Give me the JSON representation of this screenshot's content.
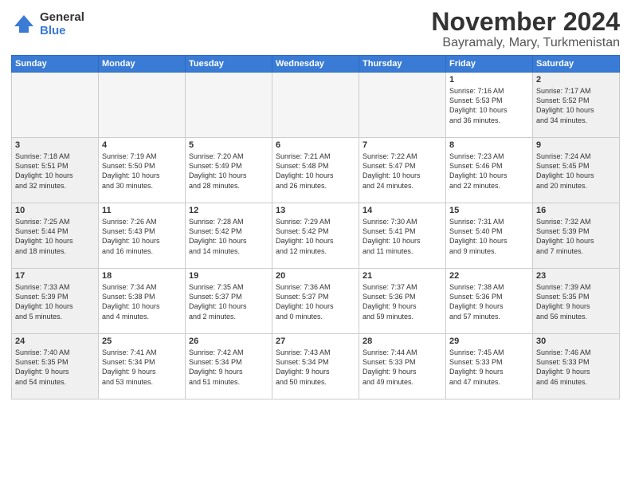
{
  "logo": {
    "general": "General",
    "blue": "Blue"
  },
  "header": {
    "month": "November 2024",
    "location": "Bayramaly, Mary, Turkmenistan"
  },
  "weekdays": [
    "Sunday",
    "Monday",
    "Tuesday",
    "Wednesday",
    "Thursday",
    "Friday",
    "Saturday"
  ],
  "weeks": [
    [
      {
        "day": "",
        "info": "",
        "empty": true
      },
      {
        "day": "",
        "info": "",
        "empty": true
      },
      {
        "day": "",
        "info": "",
        "empty": true
      },
      {
        "day": "",
        "info": "",
        "empty": true
      },
      {
        "day": "",
        "info": "",
        "empty": true
      },
      {
        "day": "1",
        "info": "Sunrise: 7:16 AM\nSunset: 5:53 PM\nDaylight: 10 hours\nand 36 minutes."
      },
      {
        "day": "2",
        "info": "Sunrise: 7:17 AM\nSunset: 5:52 PM\nDaylight: 10 hours\nand 34 minutes."
      }
    ],
    [
      {
        "day": "3",
        "info": "Sunrise: 7:18 AM\nSunset: 5:51 PM\nDaylight: 10 hours\nand 32 minutes."
      },
      {
        "day": "4",
        "info": "Sunrise: 7:19 AM\nSunset: 5:50 PM\nDaylight: 10 hours\nand 30 minutes."
      },
      {
        "day": "5",
        "info": "Sunrise: 7:20 AM\nSunset: 5:49 PM\nDaylight: 10 hours\nand 28 minutes."
      },
      {
        "day": "6",
        "info": "Sunrise: 7:21 AM\nSunset: 5:48 PM\nDaylight: 10 hours\nand 26 minutes."
      },
      {
        "day": "7",
        "info": "Sunrise: 7:22 AM\nSunset: 5:47 PM\nDaylight: 10 hours\nand 24 minutes."
      },
      {
        "day": "8",
        "info": "Sunrise: 7:23 AM\nSunset: 5:46 PM\nDaylight: 10 hours\nand 22 minutes."
      },
      {
        "day": "9",
        "info": "Sunrise: 7:24 AM\nSunset: 5:45 PM\nDaylight: 10 hours\nand 20 minutes."
      }
    ],
    [
      {
        "day": "10",
        "info": "Sunrise: 7:25 AM\nSunset: 5:44 PM\nDaylight: 10 hours\nand 18 minutes."
      },
      {
        "day": "11",
        "info": "Sunrise: 7:26 AM\nSunset: 5:43 PM\nDaylight: 10 hours\nand 16 minutes."
      },
      {
        "day": "12",
        "info": "Sunrise: 7:28 AM\nSunset: 5:42 PM\nDaylight: 10 hours\nand 14 minutes."
      },
      {
        "day": "13",
        "info": "Sunrise: 7:29 AM\nSunset: 5:42 PM\nDaylight: 10 hours\nand 12 minutes."
      },
      {
        "day": "14",
        "info": "Sunrise: 7:30 AM\nSunset: 5:41 PM\nDaylight: 10 hours\nand 11 minutes."
      },
      {
        "day": "15",
        "info": "Sunrise: 7:31 AM\nSunset: 5:40 PM\nDaylight: 10 hours\nand 9 minutes."
      },
      {
        "day": "16",
        "info": "Sunrise: 7:32 AM\nSunset: 5:39 PM\nDaylight: 10 hours\nand 7 minutes."
      }
    ],
    [
      {
        "day": "17",
        "info": "Sunrise: 7:33 AM\nSunset: 5:39 PM\nDaylight: 10 hours\nand 5 minutes."
      },
      {
        "day": "18",
        "info": "Sunrise: 7:34 AM\nSunset: 5:38 PM\nDaylight: 10 hours\nand 4 minutes."
      },
      {
        "day": "19",
        "info": "Sunrise: 7:35 AM\nSunset: 5:37 PM\nDaylight: 10 hours\nand 2 minutes."
      },
      {
        "day": "20",
        "info": "Sunrise: 7:36 AM\nSunset: 5:37 PM\nDaylight: 10 hours\nand 0 minutes."
      },
      {
        "day": "21",
        "info": "Sunrise: 7:37 AM\nSunset: 5:36 PM\nDaylight: 9 hours\nand 59 minutes."
      },
      {
        "day": "22",
        "info": "Sunrise: 7:38 AM\nSunset: 5:36 PM\nDaylight: 9 hours\nand 57 minutes."
      },
      {
        "day": "23",
        "info": "Sunrise: 7:39 AM\nSunset: 5:35 PM\nDaylight: 9 hours\nand 56 minutes."
      }
    ],
    [
      {
        "day": "24",
        "info": "Sunrise: 7:40 AM\nSunset: 5:35 PM\nDaylight: 9 hours\nand 54 minutes."
      },
      {
        "day": "25",
        "info": "Sunrise: 7:41 AM\nSunset: 5:34 PM\nDaylight: 9 hours\nand 53 minutes."
      },
      {
        "day": "26",
        "info": "Sunrise: 7:42 AM\nSunset: 5:34 PM\nDaylight: 9 hours\nand 51 minutes."
      },
      {
        "day": "27",
        "info": "Sunrise: 7:43 AM\nSunset: 5:34 PM\nDaylight: 9 hours\nand 50 minutes."
      },
      {
        "day": "28",
        "info": "Sunrise: 7:44 AM\nSunset: 5:33 PM\nDaylight: 9 hours\nand 49 minutes."
      },
      {
        "day": "29",
        "info": "Sunrise: 7:45 AM\nSunset: 5:33 PM\nDaylight: 9 hours\nand 47 minutes."
      },
      {
        "day": "30",
        "info": "Sunrise: 7:46 AM\nSunset: 5:33 PM\nDaylight: 9 hours\nand 46 minutes."
      }
    ]
  ]
}
